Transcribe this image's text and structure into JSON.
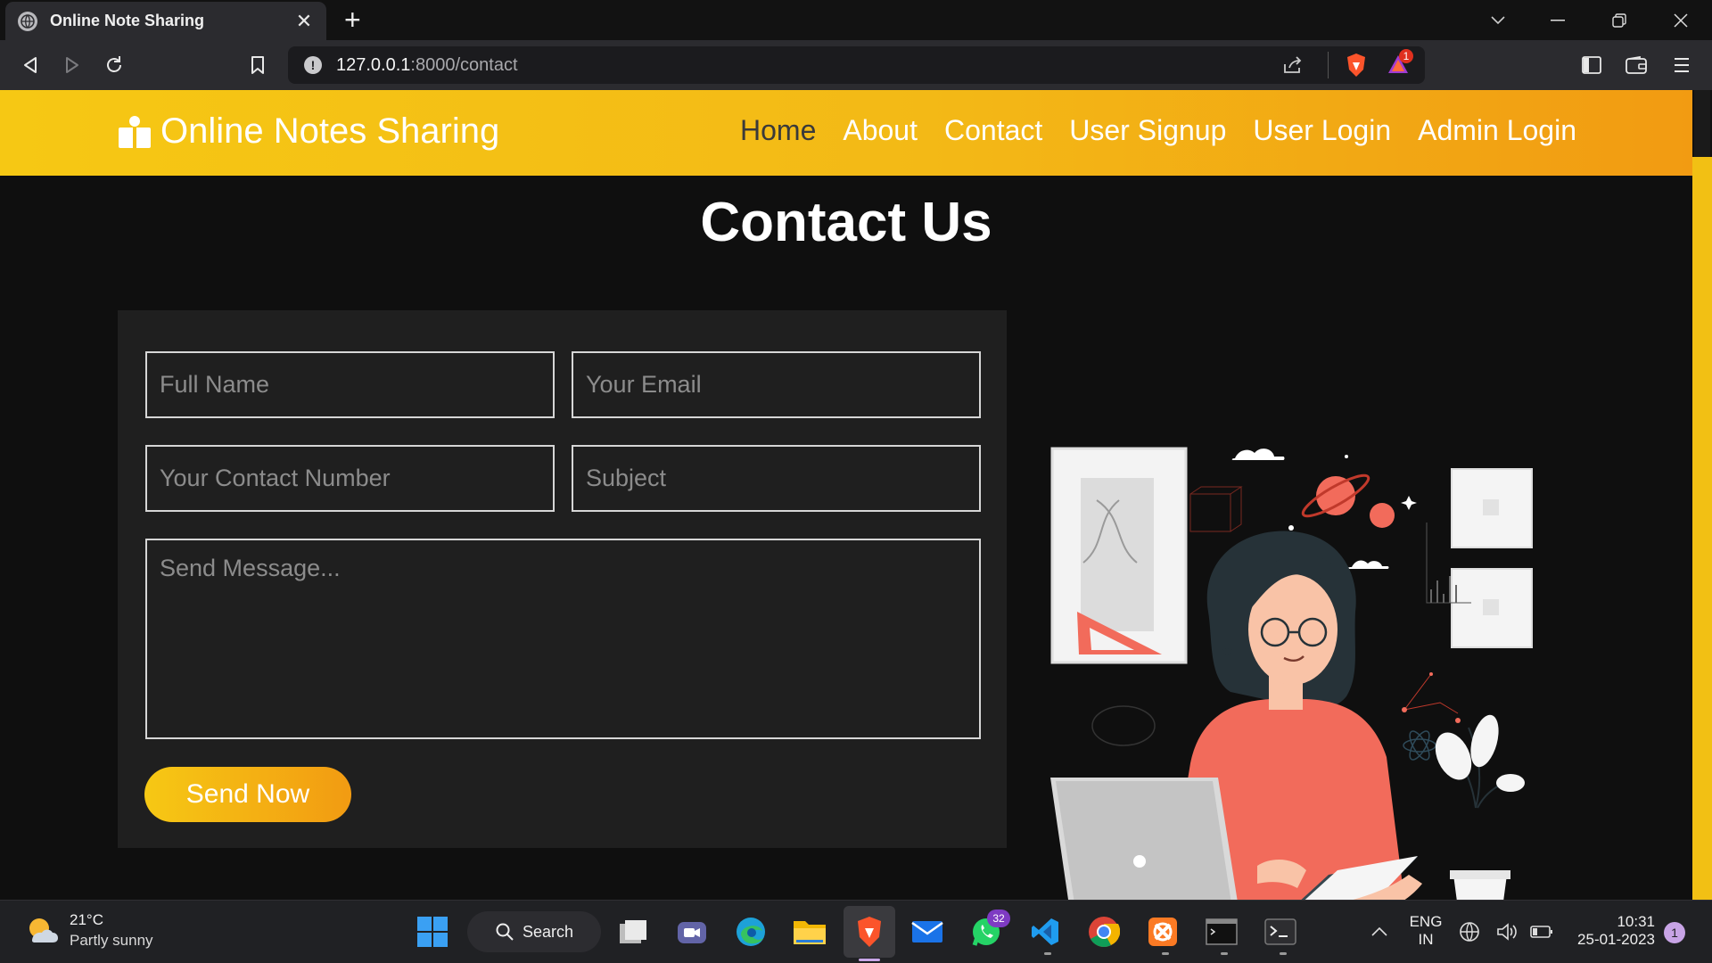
{
  "browser": {
    "tab_title": "Online Note Sharing",
    "new_tab_symbol": "+",
    "url_host": "127.0.0.1",
    "url_path": ":8000/contact",
    "brave_alert_count": "1"
  },
  "site": {
    "brand": "Online Notes Sharing",
    "nav": [
      "Home",
      "About",
      "Contact",
      "User Signup",
      "User Login",
      "Admin Login"
    ],
    "heading": "Contact Us",
    "form": {
      "full_name_placeholder": "Full Name",
      "email_placeholder": "Your Email",
      "contact_placeholder": "Your Contact Number",
      "subject_placeholder": "Subject",
      "message_placeholder": "Send Message...",
      "submit_label": "Send Now"
    },
    "colors": {
      "accent_start": "#f6c814",
      "accent_end": "#f29b12",
      "illustration_accent": "#f26b5b"
    }
  },
  "taskbar": {
    "weather_temp": "21°C",
    "weather_desc": "Partly sunny",
    "search_label": "Search",
    "whatsapp_count": "32",
    "lang_primary": "ENG",
    "lang_region": "IN",
    "time": "10:31",
    "date": "25-01-2023",
    "notification_count": "1"
  }
}
